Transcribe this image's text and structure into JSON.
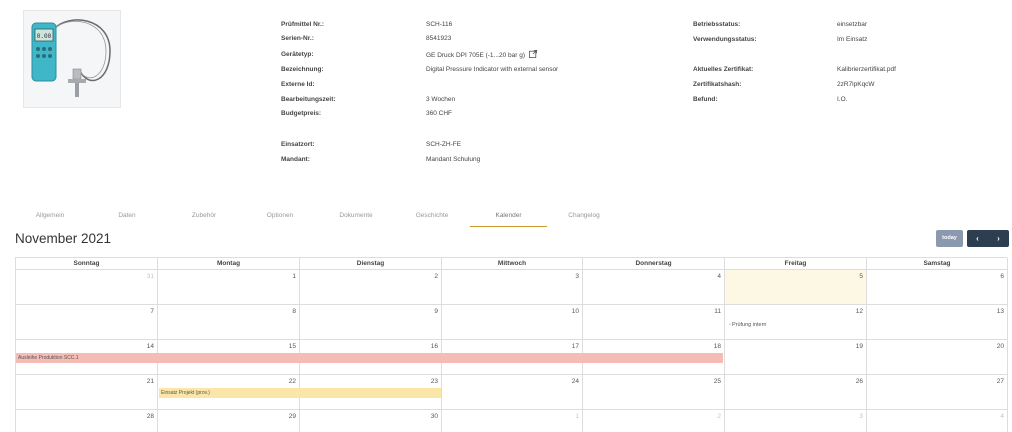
{
  "device": {
    "left_fields": [
      {
        "label": "Prüfmittel Nr.:",
        "value": "SCH-116"
      },
      {
        "label": "Serien-Nr.:",
        "value": "8541923"
      },
      {
        "label": "Gerätetyp:",
        "value": "GE Druck DPI 705E (-1...20 bar g)"
      },
      {
        "label": "Bezeichnung:",
        "value": "Digital Pressure Indicator with external sensor"
      },
      {
        "label": "Externe Id:",
        "value": ""
      },
      {
        "label": "Bearbeitungszeit:",
        "value": "3 Wochen"
      },
      {
        "label": "Budgetpreis:",
        "value": "360 CHF"
      },
      {
        "label": "Einsatzort:",
        "value": "SCH-ZH-FE"
      },
      {
        "label": "Mandant:",
        "value": "Mandant Schulung"
      }
    ],
    "right_fields": [
      {
        "label": "Betriebsstatus:",
        "value": "einsetzbar"
      },
      {
        "label": "Verwendungsstatus:",
        "value": "Im Einsatz"
      },
      {
        "label": "Aktuelles Zertifikat:",
        "value": "Kalibrierzertifikat.pdf"
      },
      {
        "label": "Zertifikatshash:",
        "value": "2zR7lpKqcW"
      },
      {
        "label": "Befund:",
        "value": "I.O."
      }
    ]
  },
  "tabs": [
    "Allgemein",
    "Daten",
    "Zubehör",
    "Optionen",
    "Dokumente",
    "Geschichte",
    "Kalender",
    "Changelog"
  ],
  "active_tab": 6,
  "calendar": {
    "title": "November 2021",
    "today_label": "today",
    "prev_label": "‹",
    "next_label": "›",
    "weekdays": [
      "Sonntag",
      "Montag",
      "Dienstag",
      "Mittwoch",
      "Donnerstag",
      "Freitag",
      "Samstag"
    ],
    "weeks": [
      [
        "31",
        "1",
        "2",
        "3",
        "4",
        "5",
        "6"
      ],
      [
        "7",
        "8",
        "9",
        "10",
        "11",
        "12",
        "13"
      ],
      [
        "14",
        "15",
        "16",
        "17",
        "18",
        "19",
        "20"
      ],
      [
        "21",
        "22",
        "23",
        "24",
        "25",
        "26",
        "27"
      ],
      [
        "28",
        "29",
        "30",
        "1",
        "2",
        "3",
        "4"
      ]
    ],
    "events": {
      "pruefung": "Prüfung intern",
      "ausleihe": "Ausleihe Produktion SCC.1",
      "einsatz": "Einsatz Projekt (prov.)"
    },
    "colors": {
      "today": "#fcf8e3",
      "event_red": "#f4bcb4",
      "event_yellow": "#fbe6a8",
      "nav": "#2c3e50",
      "today_button": "#8a99ad",
      "tab_accent": "#c99a2e"
    }
  }
}
